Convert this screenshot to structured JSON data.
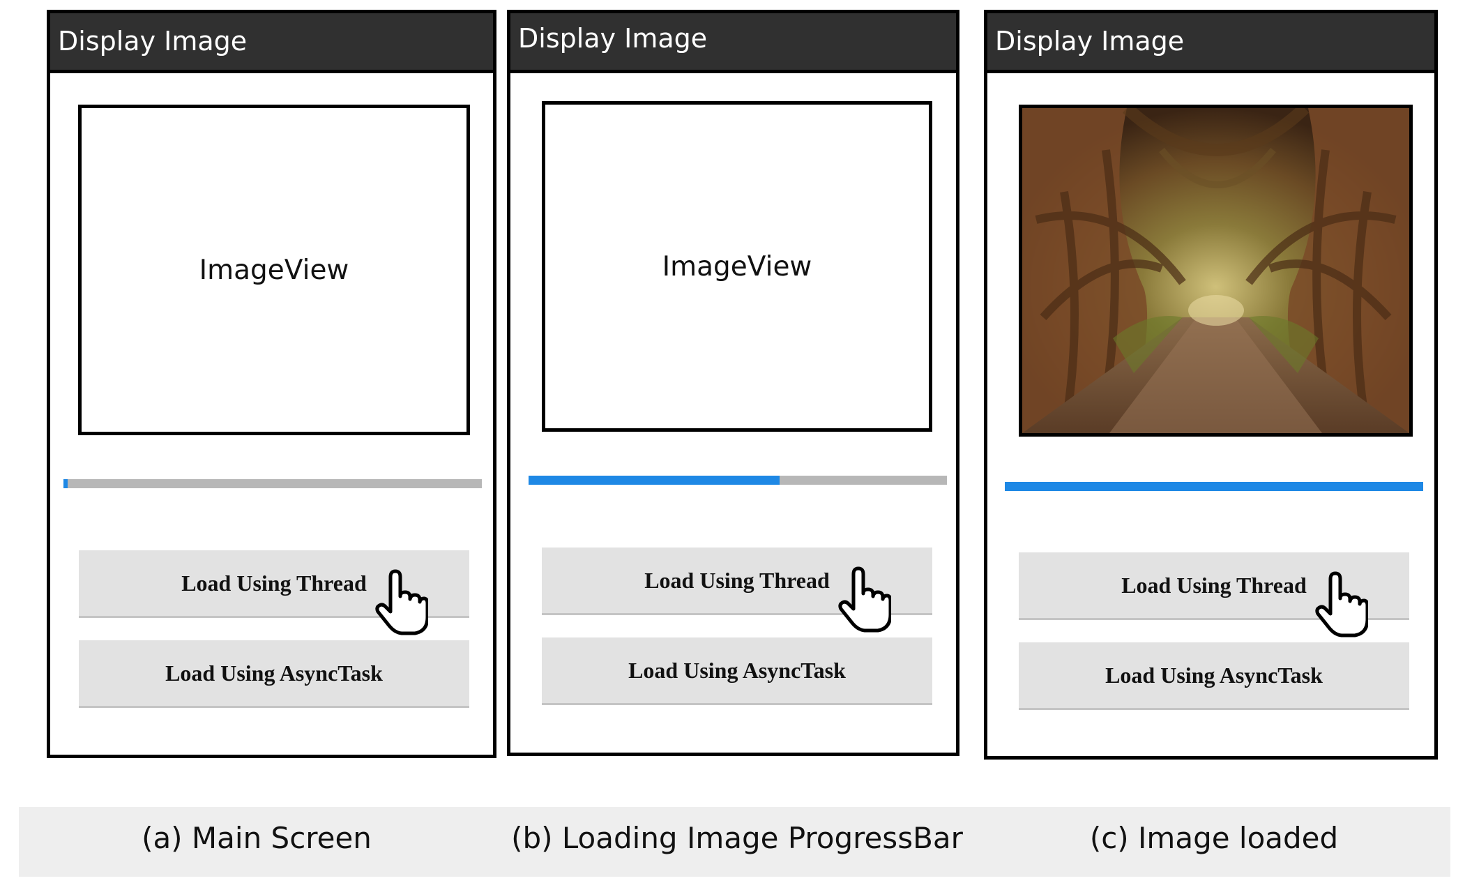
{
  "screens": [
    {
      "title": "Display Image",
      "image_placeholder": "ImageView",
      "image_loaded": false,
      "progress": 0.01,
      "buttons": [
        "Load Using Thread",
        "Load Using AsyncTask"
      ],
      "caption": "(a) Main Screen"
    },
    {
      "title": "Display Image",
      "image_placeholder": "ImageView",
      "image_loaded": false,
      "progress": 0.6,
      "buttons": [
        "Load Using Thread",
        "Load Using AsyncTask"
      ],
      "caption": "(b) Loading Image ProgressBar"
    },
    {
      "title": "Display Image",
      "image_placeholder": "",
      "image_loaded": true,
      "progress": 1.0,
      "buttons": [
        "Load Using Thread",
        "Load Using AsyncTask"
      ],
      "caption": "(c) Image loaded"
    }
  ],
  "colors": {
    "appbar": "#303030",
    "progress_fill": "#1e88e5",
    "progress_track": "#b7b7b7",
    "button_bg": "#e2e2e2"
  },
  "icons": {
    "cursor": "hand-pointer-icon"
  }
}
